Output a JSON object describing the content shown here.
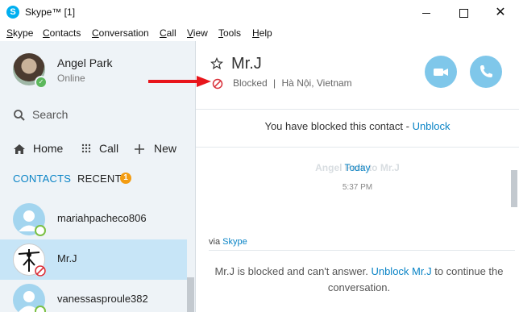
{
  "window": {
    "title": "Skype™ [1]",
    "minimize_label": "Minimize",
    "maximize_label": "Maximize",
    "close_label": "Close"
  },
  "menu": [
    {
      "label": "Skype"
    },
    {
      "label": "Contacts"
    },
    {
      "label": "Conversation"
    },
    {
      "label": "Call"
    },
    {
      "label": "View"
    },
    {
      "label": "Tools"
    },
    {
      "label": "Help"
    }
  ],
  "profile": {
    "name": "Angel Park",
    "status": "Online"
  },
  "search": {
    "label": "Search"
  },
  "nav": {
    "home": "Home",
    "call": "Call",
    "new": "New"
  },
  "tabs": {
    "contacts": "CONTACTS",
    "recent": "RECENT",
    "recent_badge": "1"
  },
  "contacts": [
    {
      "name": "mariahpacheco806",
      "status": "online"
    },
    {
      "name": "Mr.J",
      "status": "blocked"
    },
    {
      "name": "vanessasproule382",
      "status": "online"
    }
  ],
  "conversation": {
    "contact_name": "Mr.J",
    "status": "Blocked",
    "separator": "|",
    "location": "Hà Nội, Vietnam",
    "banner_text": "You have blocked this contact -",
    "banner_link": "Unblock",
    "ghost_name": "Angel Park to Mr.J",
    "day": "Today",
    "time": "5:37 PM",
    "via_prefix": "via",
    "via_link": "Skype",
    "notice_part1": "Mr.J is blocked and can't answer.",
    "notice_link": "Unblock Mr.J",
    "notice_part2": "to continue the conversation."
  },
  "colors": {
    "accent": "#0a84c6",
    "call_button": "#7fc7ea",
    "blocked": "#d9303a",
    "online": "#7bc043",
    "selected_row": "#c7e5f7",
    "badge": "#f39c12",
    "annotation_arrow": "#e8151b"
  }
}
